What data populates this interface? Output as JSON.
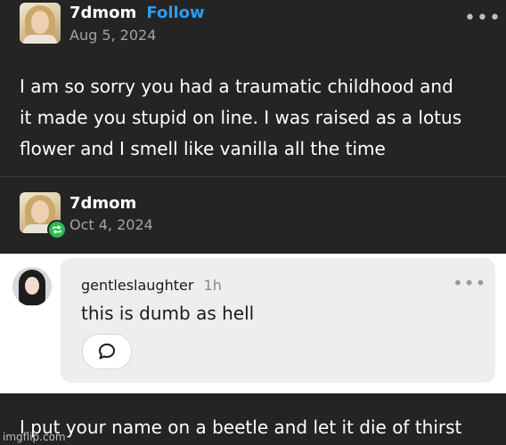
{
  "post": {
    "username": "7dmom",
    "follow_label": "Follow",
    "date": "Aug 5, 2024",
    "more_icon": "more-horizontal-icon",
    "text_lines": [
      "I am so sorry you had a traumatic childhood and",
      "it made you stupid on line. I was raised as a lotus",
      "flower and I smell like vanilla all the time"
    ]
  },
  "reblog": {
    "username": "7dmom",
    "date": "Oct 4, 2024",
    "badge_icon": "reblog-icon"
  },
  "reply": {
    "username": "gentleslaughter",
    "time": "1h",
    "text": "this is dumb as hell",
    "more_icon": "more-horizontal-icon",
    "comment_icon": "comment-bubble-icon"
  },
  "bottom_text": "I put your name on a beetle and let it die of thirst",
  "watermark": "imgflip.com",
  "colors": {
    "background": "#242424",
    "follow": "#2e9bf0",
    "reblog_badge": "#2dbb4e",
    "reply_bubble": "#eeeeee"
  }
}
